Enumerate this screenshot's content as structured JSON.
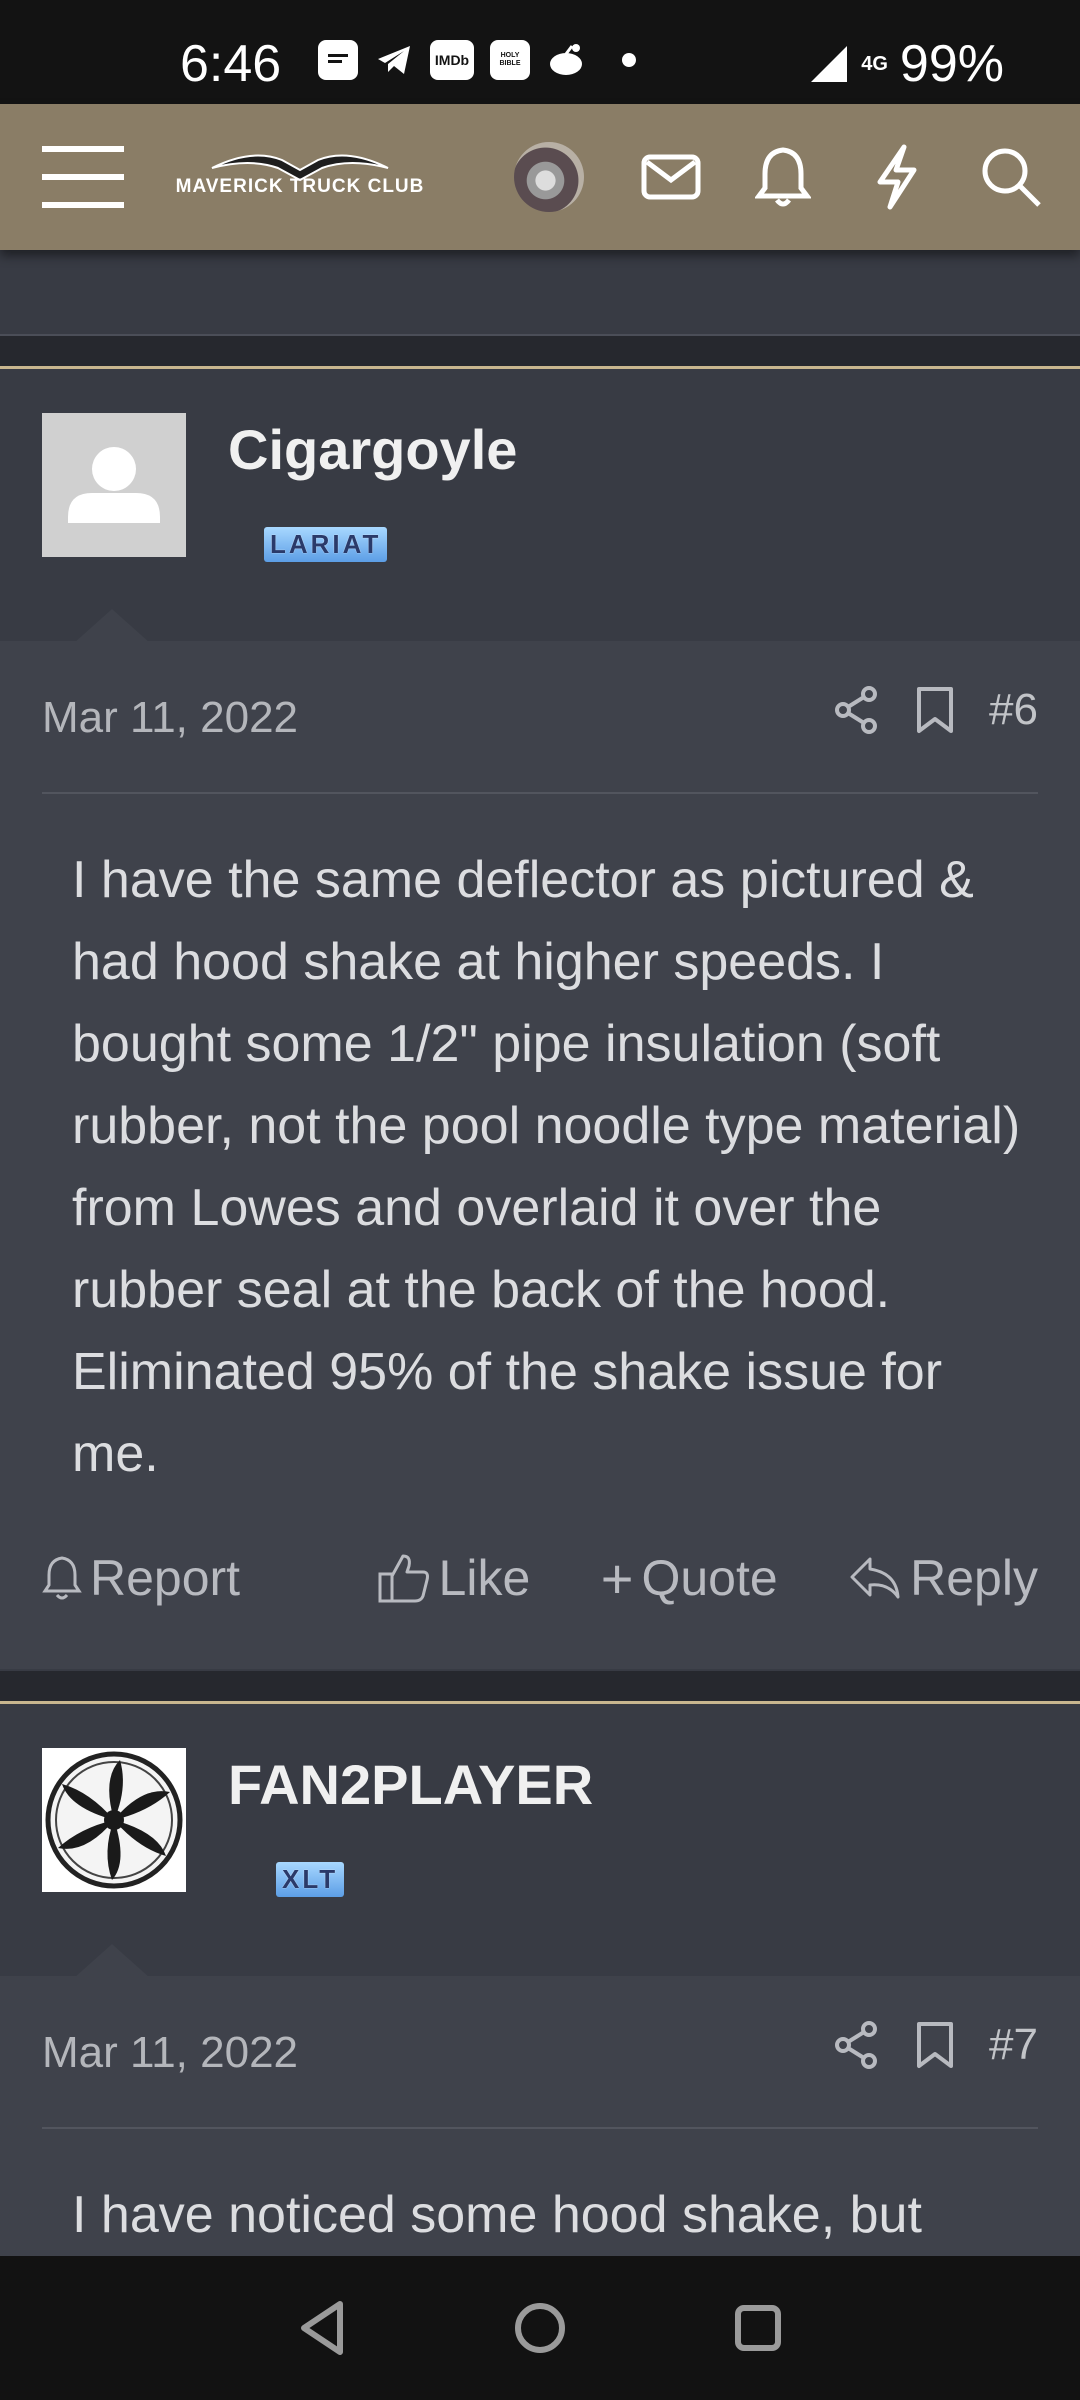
{
  "status_bar": {
    "time": "6:46",
    "app_icons": [
      "message-icon",
      "telegram-icon",
      "imdb-icon",
      "bible-icon",
      "reddit-icon",
      "dot-icon"
    ],
    "imdb_label": "IMDb",
    "bible_label": "HOLY BIBLE",
    "network": "4G",
    "battery": "99%"
  },
  "nav": {
    "logo_text": "MAVERICK TRUCK CLUB",
    "icons": [
      "menu-icon",
      "mail-icon",
      "bell-icon",
      "lightning-icon",
      "search-icon"
    ]
  },
  "posts": [
    {
      "username": "Cigargoyle",
      "rank": "LARIAT",
      "date": "Mar 11, 2022",
      "number": "#6",
      "body": "I have the same deflector as pictured & had hood shake at higher speeds. I bought some 1/2\" pipe insulation (soft rubber, not the pool noodle type material) from Lowes and overlaid it over the rubber seal at the back of the hood. Eliminated 95% of the shake issue for me.",
      "actions": {
        "report": "Report",
        "like": "Like",
        "quote": "Quote",
        "reply": "Reply"
      }
    },
    {
      "username": "FAN2PLAYER",
      "rank": "XLT",
      "date": "Mar 11, 2022",
      "number": "#7",
      "body": "I have noticed some hood shake, but"
    }
  ],
  "colors": {
    "header": "#8a7d66",
    "background": "#383b44",
    "post_body": "#3f424b",
    "accent_line": "#c8b68f"
  }
}
